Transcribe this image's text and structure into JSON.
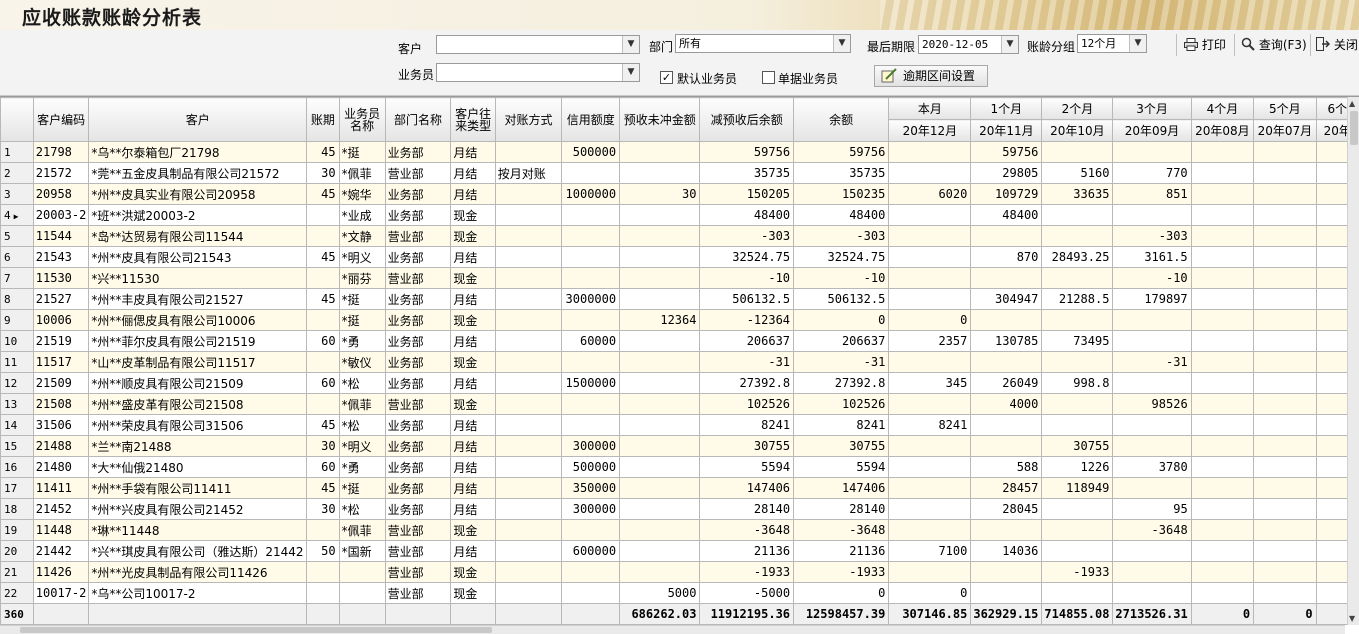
{
  "window": {
    "title": "应收账款账龄分析表"
  },
  "filters": {
    "customer_label": "客户",
    "customer_value": "",
    "salesperson_label": "业务员",
    "salesperson_value": "",
    "department_label": "部门",
    "department_value": "所有",
    "deadline_label": "最后期限",
    "deadline_value": "2020-12-05",
    "group_label": "账龄分组",
    "group_value": "12个月",
    "default_salesperson_label": "默认业务员",
    "default_salesperson_checked": true,
    "document_salesperson_label": "单据业务员",
    "document_salesperson_checked": false,
    "range_button_label": "逾期区间设置"
  },
  "toolbar": {
    "print_label": "打印",
    "query_label": "查询(F3)",
    "close_label": "关闭"
  },
  "grid": {
    "headers": {
      "code": "客户编码",
      "customer": "客户",
      "term": "账期",
      "salesperson": "业务员名称",
      "department": "部门名称",
      "type": "客户往来类型",
      "method": "对账方式",
      "credit": "信用额度",
      "prepaid": "预收未冲金额",
      "after_prepaid": "减预收后余额",
      "balance": "余额",
      "periods": [
        {
          "top": "本月",
          "bottom": "20年12月"
        },
        {
          "top": "1个月",
          "bottom": "20年11月"
        },
        {
          "top": "2个月",
          "bottom": "20年10月"
        },
        {
          "top": "3个月",
          "bottom": "20年09月"
        },
        {
          "top": "4个月",
          "bottom": "20年08月"
        },
        {
          "top": "5个月",
          "bottom": "20年07月"
        },
        {
          "top": "6个",
          "bottom": "20年"
        }
      ]
    },
    "rows": [
      {
        "n": "1",
        "code": "21798",
        "cust": "*乌**尔泰箱包厂21798",
        "term": "45",
        "sp": "*挺",
        "dept": "业务部",
        "type": "月结",
        "method": "",
        "credit": "500000",
        "pre": "",
        "after": "59756",
        "bal": "59756",
        "p": [
          "",
          "59756",
          "",
          "",
          "",
          "",
          ""
        ]
      },
      {
        "n": "2",
        "code": "21572",
        "cust": "*莞**五金皮具制品有限公司21572",
        "term": "30",
        "sp": "*佩菲",
        "dept": "营业部",
        "type": "月结",
        "method": "按月对账",
        "credit": "",
        "pre": "",
        "after": "35735",
        "bal": "35735",
        "p": [
          "",
          "29805",
          "5160",
          "770",
          "",
          "",
          ""
        ]
      },
      {
        "n": "3",
        "code": "20958",
        "cust": "*州**皮具实业有限公司20958",
        "term": "45",
        "sp": "*婉华",
        "dept": "业务部",
        "type": "月结",
        "method": "",
        "credit": "1000000",
        "pre": "30",
        "after": "150205",
        "bal": "150235",
        "p": [
          "6020",
          "109729",
          "33635",
          "851",
          "",
          "",
          ""
        ]
      },
      {
        "n": "4",
        "code": "20003-2",
        "cust": "*班**洪斌20003-2",
        "term": "",
        "sp": "*业成",
        "dept": "业务部",
        "type": "现金",
        "method": "",
        "credit": "",
        "pre": "",
        "after": "48400",
        "bal": "48400",
        "p": [
          "",
          "48400",
          "",
          "",
          "",
          "",
          ""
        ]
      },
      {
        "n": "5",
        "code": "11544",
        "cust": "*岛**达贸易有限公司11544",
        "term": "",
        "sp": "*文静",
        "dept": "营业部",
        "type": "现金",
        "method": "",
        "credit": "",
        "pre": "",
        "after": "-303",
        "bal": "-303",
        "p": [
          "",
          "",
          "",
          "-303",
          "",
          "",
          ""
        ]
      },
      {
        "n": "6",
        "code": "21543",
        "cust": "*州**皮具有限公司21543",
        "term": "45",
        "sp": "*明义",
        "dept": "业务部",
        "type": "月结",
        "method": "",
        "credit": "",
        "pre": "",
        "after": "32524.75",
        "bal": "32524.75",
        "p": [
          "",
          "870",
          "28493.25",
          "3161.5",
          "",
          "",
          ""
        ]
      },
      {
        "n": "7",
        "code": "11530",
        "cust": "*兴**11530",
        "term": "",
        "sp": "*丽芬",
        "dept": "营业部",
        "type": "现金",
        "method": "",
        "credit": "",
        "pre": "",
        "after": "-10",
        "bal": "-10",
        "p": [
          "",
          "",
          "",
          "-10",
          "",
          "",
          ""
        ]
      },
      {
        "n": "8",
        "code": "21527",
        "cust": "*州**丰皮具有限公司21527",
        "term": "45",
        "sp": "*挺",
        "dept": "业务部",
        "type": "月结",
        "method": "",
        "credit": "3000000",
        "pre": "",
        "after": "506132.5",
        "bal": "506132.5",
        "p": [
          "",
          "304947",
          "21288.5",
          "179897",
          "",
          "",
          ""
        ]
      },
      {
        "n": "9",
        "code": "10006",
        "cust": "*州**俪偲皮具有限公司10006",
        "term": "",
        "sp": "*挺",
        "dept": "业务部",
        "type": "现金",
        "method": "",
        "credit": "",
        "pre": "12364",
        "after": "-12364",
        "bal": "0",
        "p": [
          "0",
          "",
          "",
          "",
          "",
          "",
          ""
        ]
      },
      {
        "n": "10",
        "code": "21519",
        "cust": "*州**菲尔皮具有限公司21519",
        "term": "60",
        "sp": "*勇",
        "dept": "业务部",
        "type": "月结",
        "method": "",
        "credit": "60000",
        "pre": "",
        "after": "206637",
        "bal": "206637",
        "p": [
          "2357",
          "130785",
          "73495",
          "",
          "",
          "",
          ""
        ]
      },
      {
        "n": "11",
        "code": "11517",
        "cust": "*山**皮革制品有限公司11517",
        "term": "",
        "sp": "*敏仪",
        "dept": "业务部",
        "type": "现金",
        "method": "",
        "credit": "",
        "pre": "",
        "after": "-31",
        "bal": "-31",
        "p": [
          "",
          "",
          "",
          "-31",
          "",
          "",
          ""
        ]
      },
      {
        "n": "12",
        "code": "21509",
        "cust": "*州**顺皮具有限公司21509",
        "term": "60",
        "sp": "*松",
        "dept": "业务部",
        "type": "月结",
        "method": "",
        "credit": "1500000",
        "pre": "",
        "after": "27392.8",
        "bal": "27392.8",
        "p": [
          "345",
          "26049",
          "998.8",
          "",
          "",
          "",
          ""
        ]
      },
      {
        "n": "13",
        "code": "21508",
        "cust": "*州**盛皮革有限公司21508",
        "term": "",
        "sp": "*佩菲",
        "dept": "营业部",
        "type": "现金",
        "method": "",
        "credit": "",
        "pre": "",
        "after": "102526",
        "bal": "102526",
        "p": [
          "",
          "4000",
          "",
          "98526",
          "",
          "",
          ""
        ]
      },
      {
        "n": "14",
        "code": "31506",
        "cust": "*州**荣皮具有限公司31506",
        "term": "45",
        "sp": "*松",
        "dept": "业务部",
        "type": "月结",
        "method": "",
        "credit": "",
        "pre": "",
        "after": "8241",
        "bal": "8241",
        "p": [
          "8241",
          "",
          "",
          "",
          "",
          "",
          ""
        ]
      },
      {
        "n": "15",
        "code": "21488",
        "cust": "*兰**南21488",
        "term": "30",
        "sp": "*明义",
        "dept": "业务部",
        "type": "月结",
        "method": "",
        "credit": "300000",
        "pre": "",
        "after": "30755",
        "bal": "30755",
        "p": [
          "",
          "",
          "30755",
          "",
          "",
          "",
          ""
        ]
      },
      {
        "n": "16",
        "code": "21480",
        "cust": "*大**仙俄21480",
        "term": "60",
        "sp": "*勇",
        "dept": "业务部",
        "type": "月结",
        "method": "",
        "credit": "500000",
        "pre": "",
        "after": "5594",
        "bal": "5594",
        "p": [
          "",
          "588",
          "1226",
          "3780",
          "",
          "",
          ""
        ]
      },
      {
        "n": "17",
        "code": "11411",
        "cust": "*州**手袋有限公司11411",
        "term": "45",
        "sp": "*挺",
        "dept": "业务部",
        "type": "月结",
        "method": "",
        "credit": "350000",
        "pre": "",
        "after": "147406",
        "bal": "147406",
        "p": [
          "",
          "28457",
          "118949",
          "",
          "",
          "",
          ""
        ]
      },
      {
        "n": "18",
        "code": "21452",
        "cust": "*州**兴皮具有限公司21452",
        "term": "30",
        "sp": "*松",
        "dept": "业务部",
        "type": "月结",
        "method": "",
        "credit": "300000",
        "pre": "",
        "after": "28140",
        "bal": "28140",
        "p": [
          "",
          "28045",
          "",
          "95",
          "",
          "",
          ""
        ]
      },
      {
        "n": "19",
        "code": "11448",
        "cust": "*琳**11448",
        "term": "",
        "sp": "*佩菲",
        "dept": "营业部",
        "type": "现金",
        "method": "",
        "credit": "",
        "pre": "",
        "after": "-3648",
        "bal": "-3648",
        "p": [
          "",
          "",
          "",
          "-3648",
          "",
          "",
          ""
        ]
      },
      {
        "n": "20",
        "code": "21442",
        "cust": "*兴**琪皮具有限公司（雅达斯）21442",
        "term": "50",
        "sp": "*国新",
        "dept": "营业部",
        "type": "月结",
        "method": "",
        "credit": "600000",
        "pre": "",
        "after": "21136",
        "bal": "21136",
        "p": [
          "7100",
          "14036",
          "",
          "",
          "",
          "",
          ""
        ]
      },
      {
        "n": "21",
        "code": "11426",
        "cust": "*州**光皮具制品有限公司11426",
        "term": "",
        "sp": "",
        "dept": "营业部",
        "type": "现金",
        "method": "",
        "credit": "",
        "pre": "",
        "after": "-1933",
        "bal": "-1933",
        "p": [
          "",
          "",
          "-1933",
          "",
          "",
          "",
          ""
        ]
      },
      {
        "n": "22",
        "code": "10017-2",
        "cust": "*乌**公司10017-2",
        "term": "",
        "sp": "",
        "dept": "营业部",
        "type": "现金",
        "method": "",
        "credit": "",
        "pre": "5000",
        "after": "-5000",
        "bal": "0",
        "p": [
          "0",
          "",
          "",
          "",
          "",
          "",
          ""
        ]
      }
    ],
    "total": {
      "count": "360",
      "pre": "686262.03",
      "after": "11912195.36",
      "bal": "12598457.39",
      "p": [
        "307146.85",
        "362929.15",
        "714855.08",
        "2713526.31",
        "0",
        "0",
        ""
      ]
    },
    "current_row": "4"
  }
}
